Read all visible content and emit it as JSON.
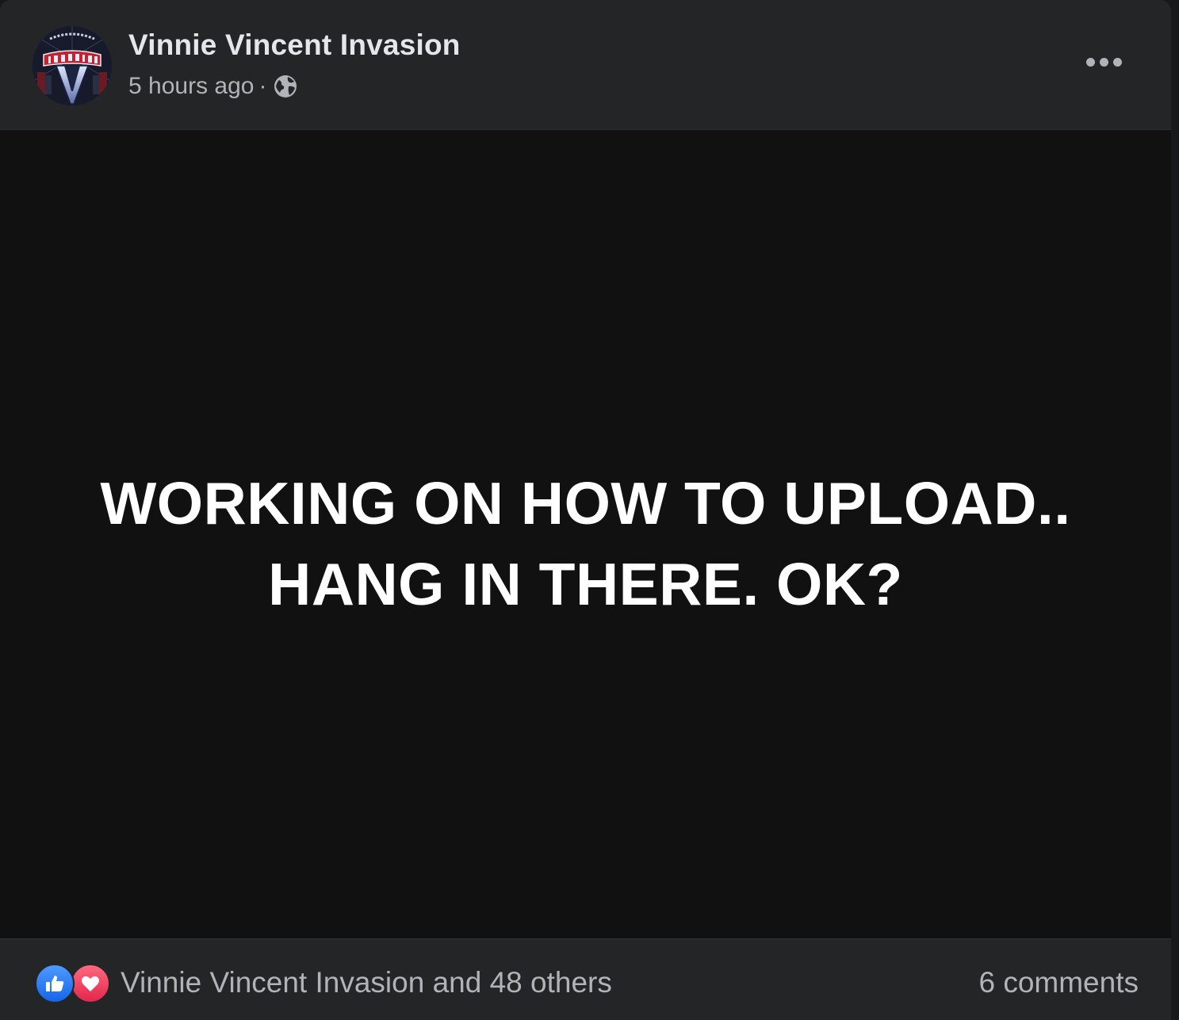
{
  "post": {
    "author": "Vinnie Vincent Invasion",
    "timestamp": "5 hours ago",
    "separator": "·",
    "privacy_icon": "globe-icon",
    "menu_icon": "more-options-icon",
    "media_lines": [
      "WORKING ON HOW TO UPLOAD..",
      "HANG IN THERE. OK?"
    ],
    "reactions": {
      "icons": [
        "like-icon",
        "love-icon"
      ],
      "summary": "Vinnie Vincent Invasion and 48 others"
    },
    "comments_count": "6 comments"
  },
  "colors": {
    "card_background": "#242526",
    "media_background": "#111112",
    "primary_text": "#e4e6eb",
    "secondary_text": "#b0b3b8",
    "like_blue": "#1877f2",
    "love_red": "#e2264d"
  }
}
